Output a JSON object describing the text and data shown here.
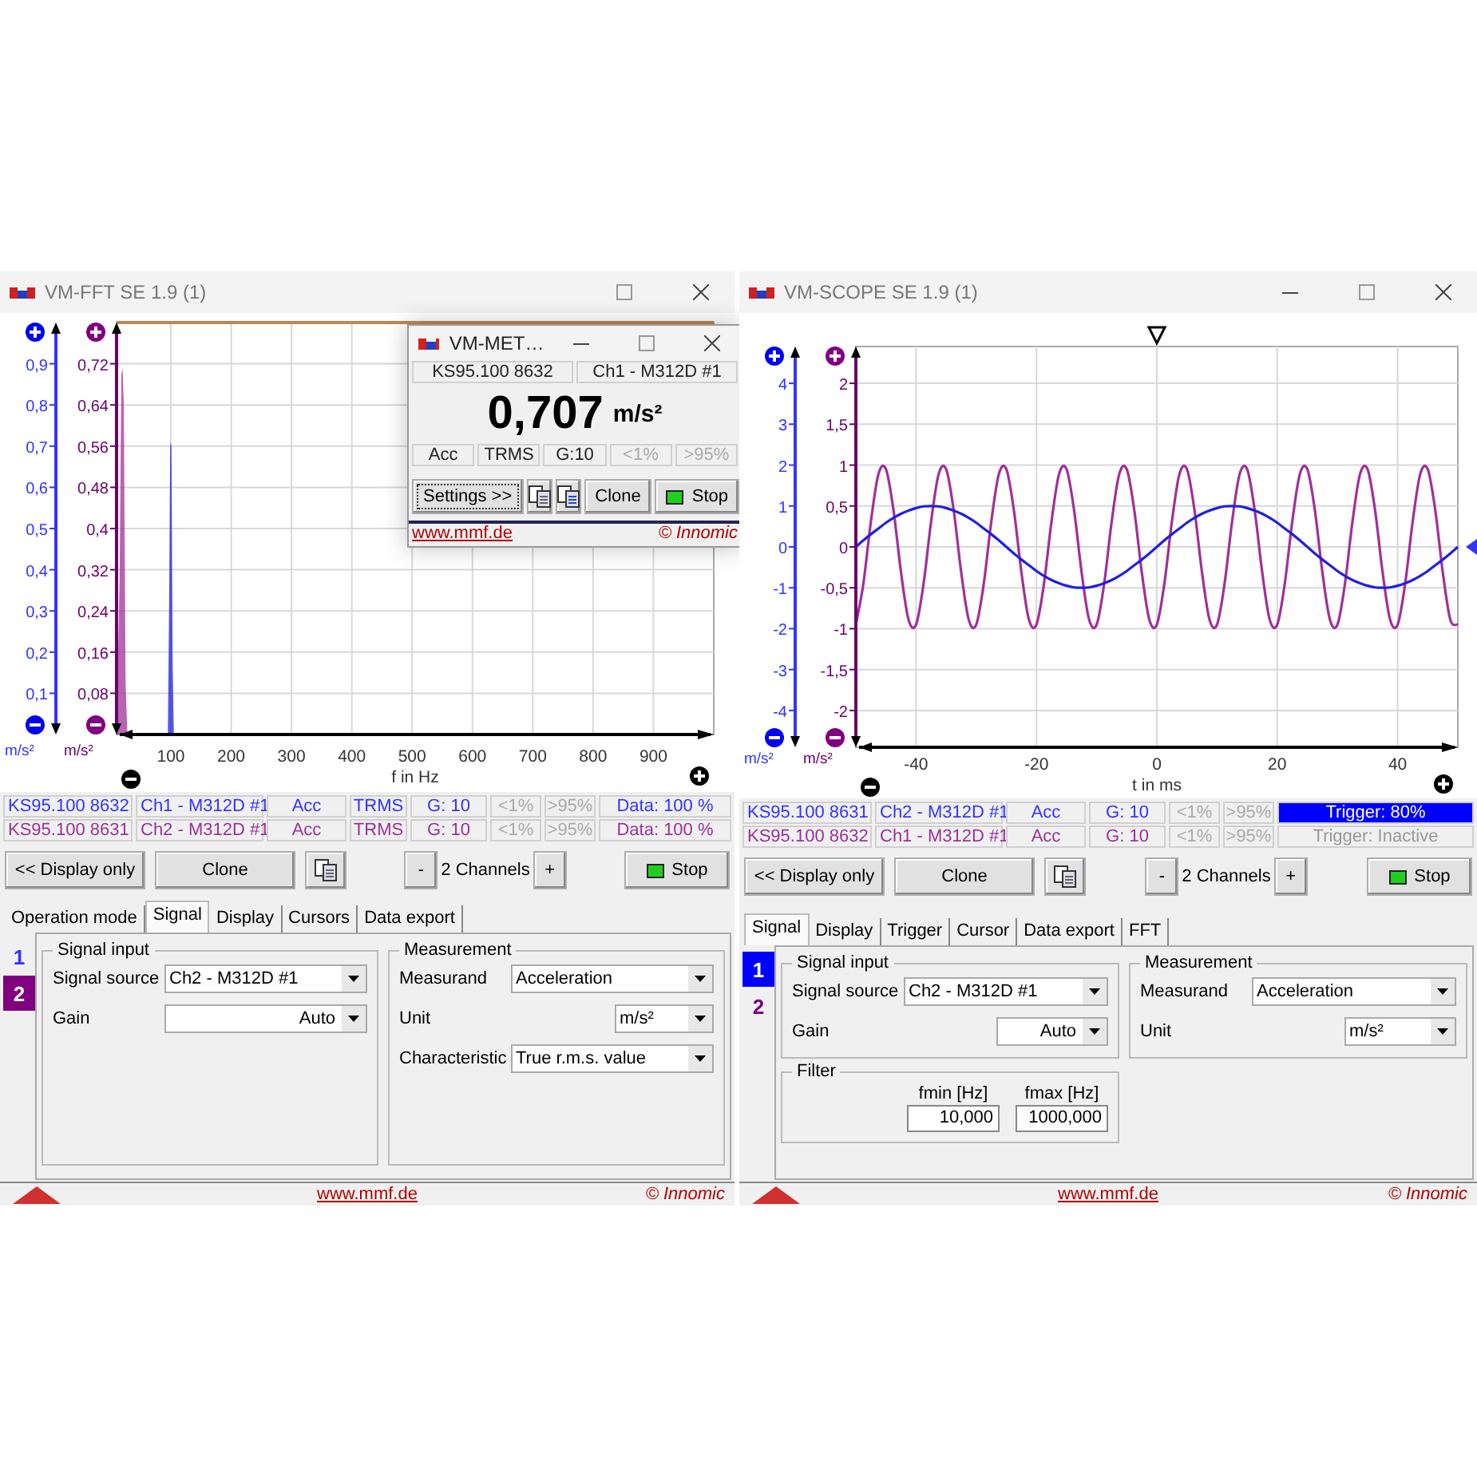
{
  "fft_window": {
    "title": "VM-FFT SE 1.9 (1)",
    "chart": {
      "y2_unit": "m/s²",
      "y_unit": "m/s²",
      "chart_data": {
        "type": "area",
        "grid": true,
        "xlabel": "f in Hz",
        "x": [
          10,
          15,
          18,
          20,
          22,
          25,
          28,
          95,
          97,
          99,
          101,
          103,
          105,
          108,
          1000
        ],
        "xlim": [
          10,
          1000
        ],
        "xticks": [
          100,
          200,
          300,
          400,
          500,
          600,
          700,
          800,
          900
        ],
        "ylim": [
          0,
          0.8
        ],
        "yticks": [
          {
            "value": 0.08,
            "label": "0,08"
          },
          {
            "value": 0.16,
            "label": "0,16"
          },
          {
            "value": 0.24,
            "label": "0,24"
          },
          {
            "value": 0.32,
            "label": "0,32"
          },
          {
            "value": 0.4,
            "label": "0,4"
          },
          {
            "value": 0.48,
            "label": "0,48"
          },
          {
            "value": 0.56,
            "label": "0,56"
          },
          {
            "value": 0.64,
            "label": "0,64"
          },
          {
            "value": 0.72,
            "label": "0,72"
          }
        ],
        "y2lim": [
          0,
          1
        ],
        "y2ticks": [
          {
            "value": 0.1,
            "label": "0,1"
          },
          {
            "value": 0.2,
            "label": "0,2"
          },
          {
            "value": 0.3,
            "label": "0,3"
          },
          {
            "value": 0.4,
            "label": "0,4"
          },
          {
            "value": 0.5,
            "label": "0,5"
          },
          {
            "value": 0.6,
            "label": "0,6"
          },
          {
            "value": 0.7,
            "label": "0,7"
          },
          {
            "value": 0.8,
            "label": "0,8"
          },
          {
            "value": 0.9,
            "label": "0,9"
          }
        ],
        "series": [
          {
            "color": "#2020e0",
            "axis": "y2",
            "values": [
              0,
              0,
              0,
              0,
              0,
              0,
              0,
              0,
              0.3,
              0.71,
              0.7,
              0.17,
              0,
              0,
              0
            ]
          },
          {
            "color": "#a0309a",
            "axis": "y",
            "values": [
              0,
              0.3,
              0.7,
              0.71,
              0.64,
              0.1,
              0,
              0,
              0,
              0,
              0,
              0,
              0,
              0,
              0
            ]
          }
        ]
      }
    },
    "channels": [
      {
        "serial": "KS95.100 8632",
        "channel": "Ch1 - M312D #1",
        "measurand": "Acc",
        "characteristic": "TRMS",
        "gain": "G: 10",
        "indicators": [
          {
            "label": "<1%",
            "lit": false
          },
          {
            "label": ">95%",
            "lit": false
          }
        ],
        "status": {
          "text": "Data: 100 %",
          "highlighted": false,
          "dimmed": false
        },
        "color": "#3333ff"
      },
      {
        "serial": "KS95.100 8631",
        "channel": "Ch2 - M312D #1",
        "measurand": "Acc",
        "characteristic": "TRMS",
        "gain": "G: 10",
        "indicators": [
          {
            "label": "<1%",
            "lit": false
          },
          {
            "label": ">95%",
            "lit": false
          }
        ],
        "status": {
          "text": "Data: 100 %",
          "highlighted": false,
          "dimmed": false
        },
        "color": "#993399"
      }
    ],
    "toolbar": {
      "display_only": "<< Display only",
      "clone": "Clone",
      "minus": "-",
      "channel_count": "2 Channels",
      "plus": "+",
      "stop": "Stop"
    },
    "tabs": [
      {
        "label": "Operation mode",
        "selected": false
      },
      {
        "label": "Signal",
        "selected": true
      },
      {
        "label": "Display",
        "selected": false
      },
      {
        "label": "Cursors",
        "selected": false
      },
      {
        "label": "Data export",
        "selected": false
      }
    ],
    "channel_tabs": [
      {
        "label": "1",
        "selected": false,
        "color": "#3333ff"
      },
      {
        "label": "2",
        "selected": true,
        "color": "#800080"
      }
    ],
    "panel": {
      "columns": [
        [
          {
            "title": "Signal input",
            "fields": [
              {
                "kind": "dropdown",
                "label": "Signal source",
                "value": "Ch2 - M312D #1"
              },
              {
                "kind": "right_dropdown",
                "label": "Gain",
                "value": "Auto"
              }
            ]
          }
        ],
        [
          {
            "title": "Measurement",
            "fields": [
              {
                "kind": "dropdown",
                "label": "Measurand",
                "value": "Acceleration"
              },
              {
                "kind": "short_dropdown",
                "label": "Unit",
                "value": "m/s²"
              },
              {
                "kind": "dropdown",
                "label": "Characteristic",
                "value": "True r.m.s. value"
              }
            ]
          }
        ]
      ]
    },
    "footer": {
      "link": "www.mmf.de",
      "copyright": "© Innomic"
    }
  },
  "meter_window": {
    "title": "VM-MET…",
    "serial": "KS95.100 8632",
    "channel": "Ch1 - M312D #1",
    "value": "0,707",
    "unit": "m/s²",
    "cells": [
      "Acc",
      "TRMS",
      "G:10"
    ],
    "indicators": [
      {
        "label": "<1%",
        "lit": false
      },
      {
        "label": ">95%",
        "lit": false
      }
    ],
    "buttons": {
      "settings": "Settings >>",
      "clone": "Clone",
      "stop": "Stop"
    },
    "footer": {
      "link": "www.mmf.de",
      "copyright": "© Innomic"
    }
  },
  "scope_window": {
    "title": "VM-SCOPE SE 1.9 (1)",
    "chart": {
      "y2_unit": "m/s²",
      "y_unit": "m/s²",
      "chart_data": {
        "type": "line",
        "grid": true,
        "xlabel": "t in ms",
        "x": [
          -50,
          -48.75,
          -47.5,
          -46.25,
          -45,
          -43.75,
          -42.5,
          -41.25,
          -40,
          -38.75,
          -37.5,
          -36.25,
          -35,
          -33.75,
          -32.5,
          -31.25,
          -30,
          -28.75,
          -27.5,
          -26.25,
          -25,
          -23.75,
          -22.5,
          -21.25,
          -20,
          -18.75,
          -17.5,
          -16.25,
          -15,
          -13.75,
          -12.5,
          -11.25,
          -10,
          -8.75,
          -7.5,
          -6.25,
          -5,
          -3.75,
          -2.5,
          -1.25,
          0,
          1.25,
          2.5,
          3.75,
          5,
          6.25,
          7.5,
          8.75,
          10,
          11.25,
          12.5,
          13.75,
          15,
          16.25,
          17.5,
          18.75,
          20,
          21.25,
          22.5,
          23.75,
          25,
          26.25,
          27.5,
          28.75,
          30,
          31.25,
          32.5,
          33.75,
          35,
          36.25,
          37.5,
          38.75,
          40,
          41.25,
          42.5,
          43.75,
          45,
          46.25,
          47.5,
          48.75,
          50
        ],
        "xlim": [
          -50,
          50
        ],
        "xticks": [
          -40,
          -20,
          0,
          20,
          40
        ],
        "ylim": [
          -2.45,
          2.45
        ],
        "yticks": [
          2,
          {
            "value": 1.5,
            "label": "1,5"
          },
          1,
          {
            "value": 0.5,
            "label": "0,5"
          },
          0,
          {
            "value": -0.5,
            "label": "-0,5"
          },
          -1,
          {
            "value": -1.5,
            "label": "-1,5"
          },
          -2
        ],
        "y2lim": [
          -4.9,
          4.9
        ],
        "y2ticks": [
          4,
          3,
          2,
          1,
          0,
          -1,
          -2,
          -3,
          -4
        ],
        "series": [
          {
            "color": "#a0309a",
            "axis": "y",
            "values": [
              -0.95,
              -0.45,
              0.31,
              0.89,
              0.95,
              0.45,
              -0.31,
              -0.89,
              -0.95,
              -0.45,
              0.31,
              0.89,
              0.95,
              0.45,
              -0.31,
              -0.89,
              -0.95,
              -0.45,
              0.31,
              0.89,
              0.95,
              0.45,
              -0.31,
              -0.89,
              -0.95,
              -0.45,
              0.31,
              0.89,
              0.95,
              0.45,
              -0.31,
              -0.89,
              -0.95,
              -0.45,
              0.31,
              0.89,
              0.95,
              0.45,
              -0.31,
              -0.89,
              -0.95,
              -0.45,
              0.31,
              0.89,
              0.95,
              0.45,
              -0.31,
              -0.89,
              -0.95,
              -0.45,
              0.31,
              0.89,
              0.95,
              0.45,
              -0.31,
              -0.89,
              -0.95,
              -0.45,
              0.31,
              0.89,
              0.95,
              0.45,
              -0.31,
              -0.89,
              -0.95,
              -0.45,
              0.31,
              0.89,
              0.95,
              0.45,
              -0.31,
              -0.89,
              -0.95,
              -0.45,
              0.31,
              0.89,
              0.95,
              0.45,
              -0.31,
              -0.89,
              -0.95
            ]
          },
          {
            "color": "#2020e0",
            "axis": "y2",
            "values": [
              0,
              0.16,
              0.31,
              0.45,
              0.59,
              0.71,
              0.81,
              0.89,
              0.95,
              0.99,
              1,
              0.99,
              0.95,
              0.89,
              0.81,
              0.71,
              0.59,
              0.45,
              0.31,
              0.16,
              0,
              -0.16,
              -0.31,
              -0.45,
              -0.59,
              -0.71,
              -0.81,
              -0.89,
              -0.95,
              -0.99,
              -1,
              -0.99,
              -0.95,
              -0.89,
              -0.81,
              -0.71,
              -0.59,
              -0.45,
              -0.31,
              -0.16,
              0,
              0.16,
              0.31,
              0.45,
              0.59,
              0.71,
              0.81,
              0.89,
              0.95,
              0.99,
              1,
              0.99,
              0.95,
              0.89,
              0.81,
              0.71,
              0.59,
              0.45,
              0.31,
              0.16,
              0,
              -0.16,
              -0.31,
              -0.45,
              -0.59,
              -0.71,
              -0.81,
              -0.89,
              -0.95,
              -0.99,
              -1,
              -0.99,
              -0.95,
              -0.89,
              -0.81,
              -0.71,
              -0.59,
              -0.45,
              -0.31,
              -0.16,
              0
            ]
          }
        ]
      }
    },
    "channels": [
      {
        "serial": "KS95.100 8631",
        "channel": "Ch2 - M312D #1",
        "measurand": "Acc",
        "gain": "G: 10",
        "indicators": [
          {
            "label": "<1%",
            "lit": false
          },
          {
            "label": ">95%",
            "lit": false
          }
        ],
        "status": {
          "text": "Trigger: 80%",
          "highlighted": true,
          "dimmed": false
        },
        "color": "#3333ff"
      },
      {
        "serial": "KS95.100 8632",
        "channel": "Ch1 - M312D #1",
        "measurand": "Acc",
        "gain": "G: 10",
        "indicators": [
          {
            "label": "<1%",
            "lit": false
          },
          {
            "label": ">95%",
            "lit": false
          }
        ],
        "status": {
          "text": "Trigger: Inactive",
          "highlighted": false,
          "dimmed": true
        },
        "color": "#993399"
      }
    ],
    "toolbar": {
      "display_only": "<< Display only",
      "clone": "Clone",
      "minus": "-",
      "channel_count": "2 Channels",
      "plus": "+",
      "stop": "Stop"
    },
    "tabs": [
      {
        "label": "Signal",
        "selected": true
      },
      {
        "label": "Display",
        "selected": false
      },
      {
        "label": "Trigger",
        "selected": false
      },
      {
        "label": "Cursor",
        "selected": false
      },
      {
        "label": "Data export",
        "selected": false
      },
      {
        "label": "FFT",
        "selected": false
      }
    ],
    "channel_tabs": [
      {
        "label": "1",
        "selected": true,
        "color": "#0000ff"
      },
      {
        "label": "2",
        "selected": false,
        "color": "#800080"
      }
    ],
    "panel": {
      "columns": [
        [
          {
            "title": "Signal input",
            "fields": [
              {
                "kind": "dropdown",
                "label": "Signal source",
                "value": "Ch2 - M312D #1"
              },
              {
                "kind": "short_right_dropdown",
                "label": "Gain",
                "value": "Auto"
              }
            ]
          },
          {
            "title": "Filter",
            "fields": [
              {
                "kind": "number",
                "label": "fmin [Hz]",
                "value": "10,000"
              },
              {
                "kind": "number",
                "label": "fmax [Hz]",
                "value": "1000,000"
              }
            ]
          }
        ],
        [
          {
            "title": "Measurement",
            "fields": [
              {
                "kind": "dropdown",
                "label": "Measurand",
                "value": "Acceleration"
              },
              {
                "kind": "short_dropdown",
                "label": "Unit",
                "value": "m/s²"
              }
            ]
          }
        ]
      ]
    },
    "footer": {
      "link": "www.mmf.de",
      "copyright": "© Innomic"
    }
  }
}
